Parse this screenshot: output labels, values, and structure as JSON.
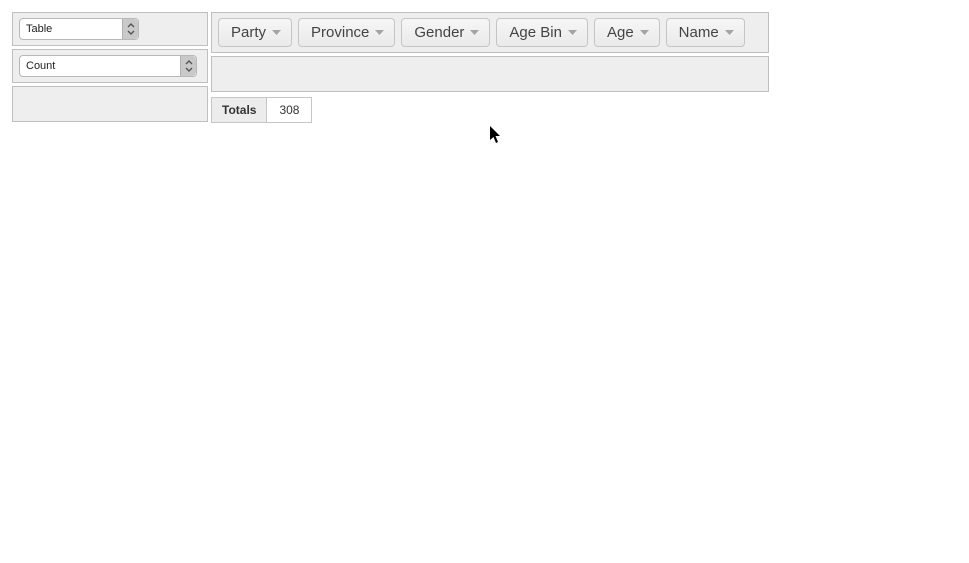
{
  "renderer": {
    "selected": "Table"
  },
  "aggregator": {
    "selected": "Count"
  },
  "unused_attrs": [
    {
      "label": "Party"
    },
    {
      "label": "Province"
    },
    {
      "label": "Gender"
    },
    {
      "label": "Age Bin"
    },
    {
      "label": "Age"
    },
    {
      "label": "Name"
    }
  ],
  "pivot": {
    "row_label": "Totals",
    "grand_total": "308"
  }
}
